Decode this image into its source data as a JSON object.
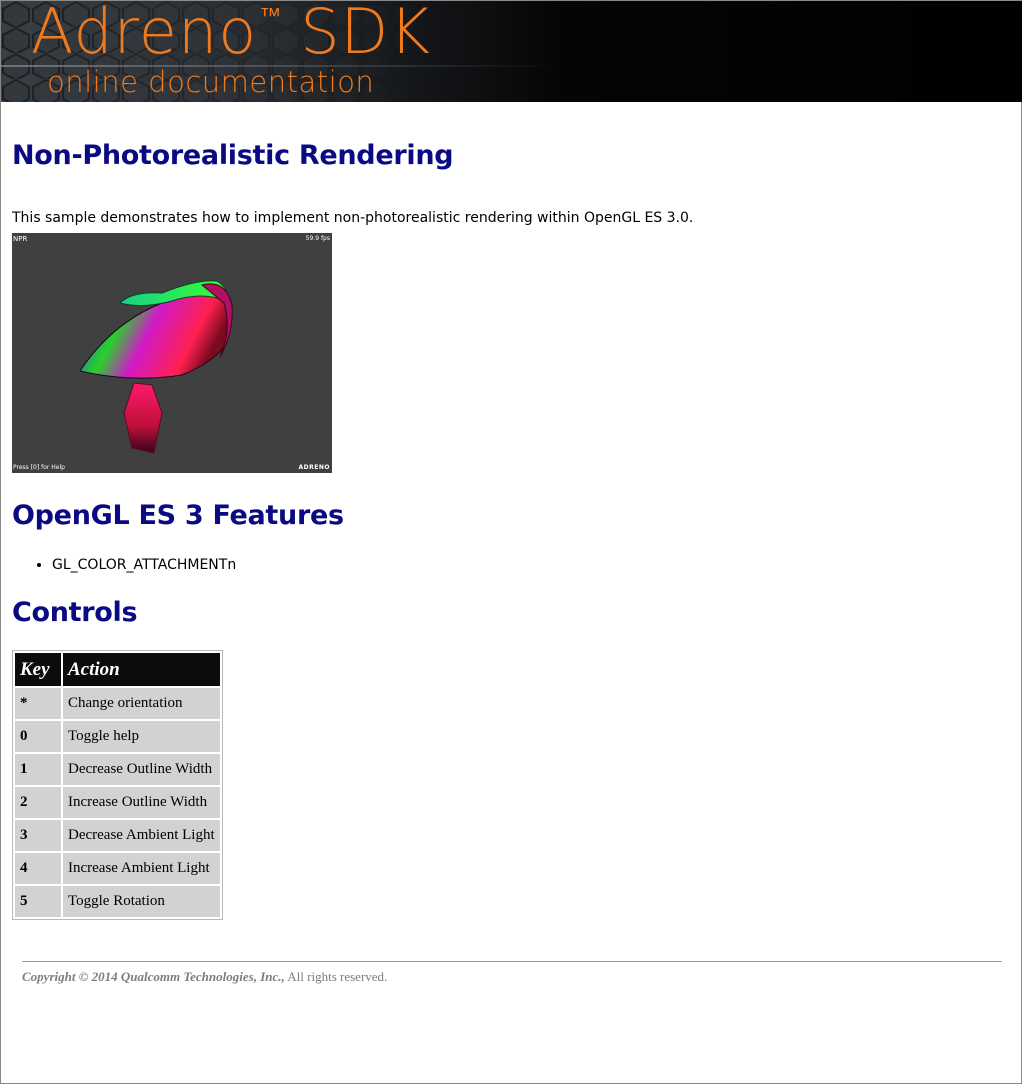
{
  "banner": {
    "brand": "Adreno",
    "trademark": "™",
    "product": "SDK",
    "subtitle": "online documentation"
  },
  "page": {
    "title": "Non-Photorealistic Rendering",
    "intro": "This sample demonstrates how to implement non-photorealistic rendering within OpenGL ES 3.0."
  },
  "screenshot": {
    "label_top_left": "NPR",
    "fps": "59.9 fps",
    "help_hint": "Press [0] for Help",
    "logo": "ADRENO"
  },
  "features": {
    "heading": "OpenGL ES 3 Features",
    "items": [
      "GL_COLOR_ATTACHMENTn"
    ]
  },
  "controls": {
    "heading": "Controls",
    "columns": [
      "Key",
      "Action"
    ],
    "rows": [
      {
        "key": "*",
        "action": "Change orientation"
      },
      {
        "key": "0",
        "action": "Toggle help"
      },
      {
        "key": "1",
        "action": "Decrease Outline Width"
      },
      {
        "key": "2",
        "action": "Increase Outline Width"
      },
      {
        "key": "3",
        "action": "Decrease Ambient Light"
      },
      {
        "key": "4",
        "action": "Increase Ambient Light"
      },
      {
        "key": "5",
        "action": "Toggle Rotation"
      }
    ]
  },
  "footer": {
    "copyright": "Copyright © 2014 Qualcomm Technologies, Inc.,",
    "rights": "All rights reserved."
  },
  "colors": {
    "heading": "#0a0a82",
    "brand_orange": "#f07a1e",
    "table_header_bg": "#0c0c0c",
    "table_cell_bg": "#d2d2d2"
  }
}
